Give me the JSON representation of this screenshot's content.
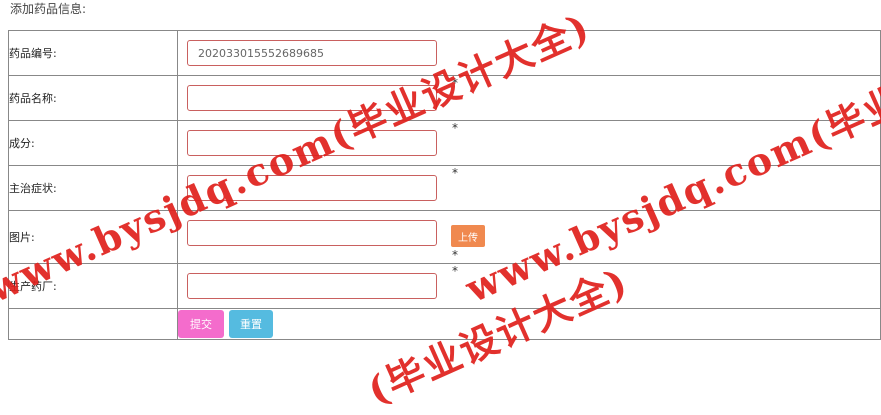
{
  "page": {
    "title": "添加药品信息:"
  },
  "form": {
    "rows": [
      {
        "label": "药品编号:",
        "value": "202033015552689685",
        "required": ""
      },
      {
        "label": "药品名称:",
        "value": "",
        "required": "*"
      },
      {
        "label": "成分:",
        "value": "",
        "required": "*"
      },
      {
        "label": "主治症状:",
        "value": "",
        "required": "*"
      },
      {
        "label": "图片:",
        "value": "",
        "required": "*"
      },
      {
        "label": "生产药厂:",
        "value": "",
        "required": "*"
      }
    ],
    "upload_label": "上传",
    "submit_label": "提交",
    "reset_label": "重置"
  },
  "watermark": {
    "text_1": "www.bysjdq.com(毕业设计大全)",
    "text_2": "www.bysjdq.com(毕业设计大全)",
    "text_3": "(毕业设计大全)"
  },
  "colors": {
    "input_border": "#c9605f",
    "upload_button": "#f0894f",
    "submit_button": "#f46ccc",
    "reset_button": "#55bbe0",
    "watermark": "#e0201c"
  }
}
